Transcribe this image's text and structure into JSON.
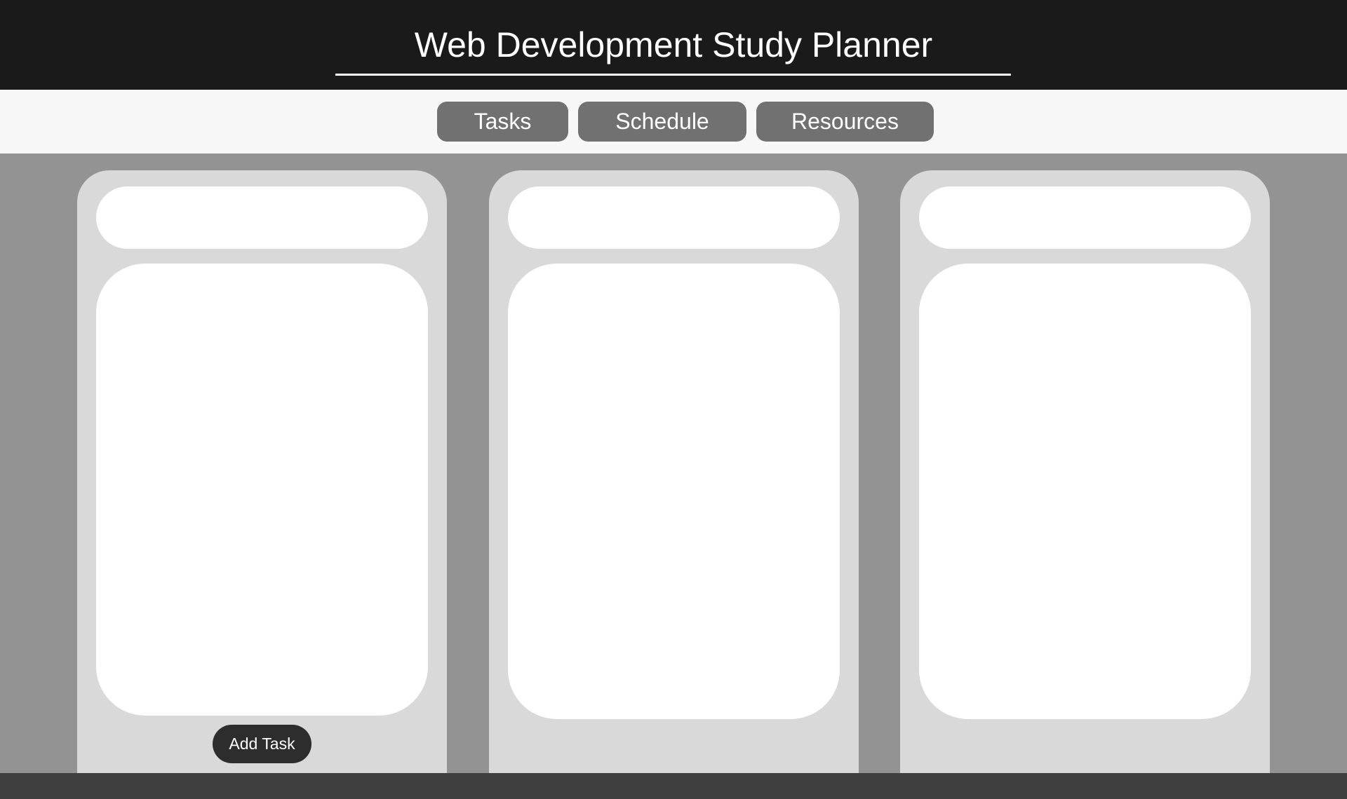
{
  "header": {
    "title": "Web Development Study Planner"
  },
  "nav": {
    "items": [
      {
        "label": "Tasks"
      },
      {
        "label": "Schedule"
      },
      {
        "label": "Resources"
      }
    ]
  },
  "columns": [
    {
      "header": "",
      "body": "",
      "action_label": "Add Task"
    },
    {
      "header": "",
      "body": ""
    },
    {
      "header": "",
      "body": ""
    }
  ],
  "colors": {
    "header_bg": "#1a1a1a",
    "nav_bg": "#f7f7f7",
    "nav_button": "#717171",
    "main_bg": "#939393",
    "column_bg": "#d9d9d9",
    "panel_bg": "#ffffff",
    "action_button": "#2d2d2d",
    "footer_bg": "#3f3f3f"
  }
}
